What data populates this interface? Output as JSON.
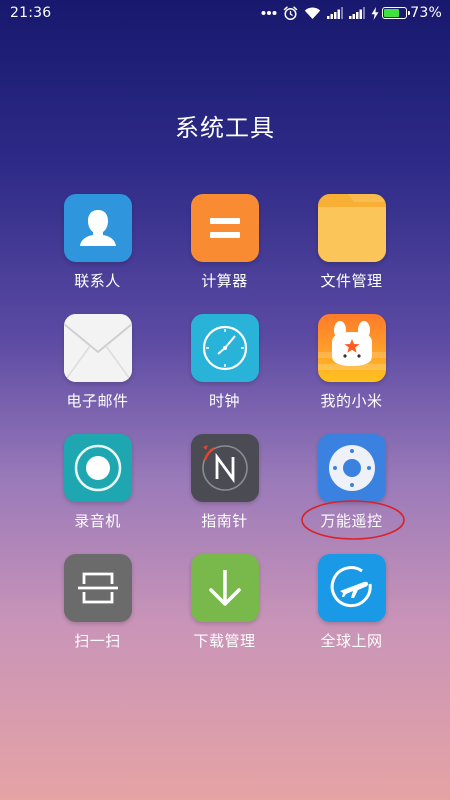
{
  "status_bar": {
    "time": "21:36",
    "battery_percent_text": "73%",
    "battery_level": 0.73,
    "icons": [
      "more-dots-icon",
      "alarm-icon",
      "wifi-icon",
      "signal-icon",
      "signal-icon",
      "charging-icon",
      "battery-icon"
    ]
  },
  "folder": {
    "title": "系统工具"
  },
  "apps": [
    {
      "label": "联系人",
      "icon": "contacts-icon"
    },
    {
      "label": "计算器",
      "icon": "calculator-icon"
    },
    {
      "label": "文件管理",
      "icon": "folder-icon"
    },
    {
      "label": "电子邮件",
      "icon": "email-icon"
    },
    {
      "label": "时钟",
      "icon": "clock-icon"
    },
    {
      "label": "我的小米",
      "icon": "mi-bunny-icon"
    },
    {
      "label": "录音机",
      "icon": "recorder-icon"
    },
    {
      "label": "指南针",
      "icon": "compass-icon"
    },
    {
      "label": "万能遥控",
      "icon": "remote-control-icon",
      "highlighted": true
    },
    {
      "label": "扫一扫",
      "icon": "scan-icon"
    },
    {
      "label": "下载管理",
      "icon": "download-icon"
    },
    {
      "label": "全球上网",
      "icon": "global-internet-icon"
    }
  ],
  "colors": {
    "highlight_ring": "#d8232a",
    "battery_fill": "#3fe23f"
  }
}
